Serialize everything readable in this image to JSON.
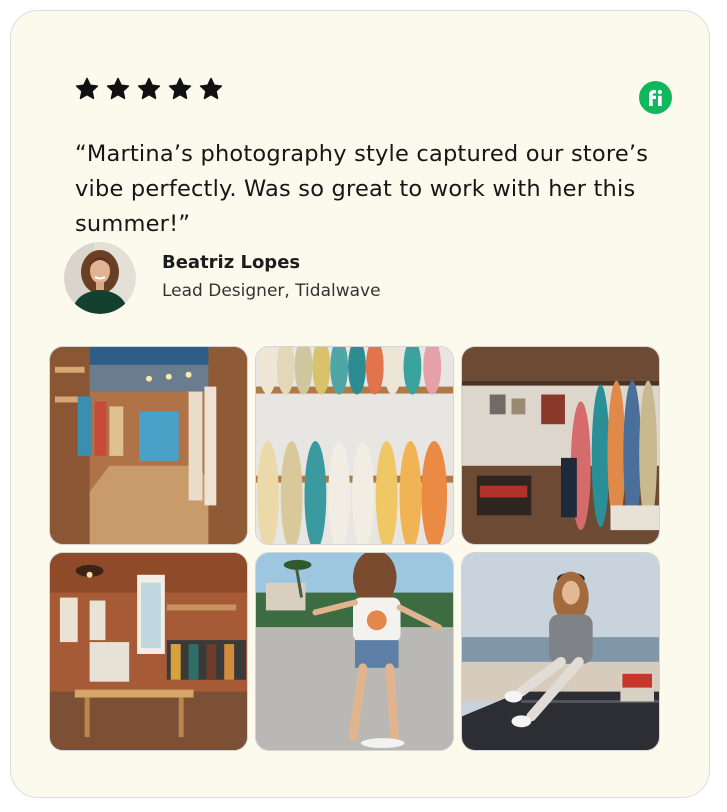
{
  "rating": {
    "stars": 5,
    "max": 5,
    "icon": "star-icon",
    "color": "#111111"
  },
  "brand": {
    "icon": "fiverr-logo-icon",
    "letter": "fi",
    "color": "#0fb85c"
  },
  "testimonial": {
    "quote": "“Martina’s photography style captured our store’s vibe perfectly. Was so great to work with her this summer!”"
  },
  "author": {
    "name": "Beatriz Lopes",
    "role": "Lead Designer, Tidalwave"
  },
  "gallery": {
    "photos": [
      "surf-shop-interior-photo",
      "surfboard-wall-photo",
      "surfboard-shop-display-photo",
      "clothing-store-interior-photo",
      "girl-skateboarding-photo",
      "girl-on-car-roof-photo"
    ]
  },
  "colors": {
    "card_background": "#fcfaec",
    "card_border": "#dcdcdc",
    "brand_green": "#0fb85c"
  }
}
